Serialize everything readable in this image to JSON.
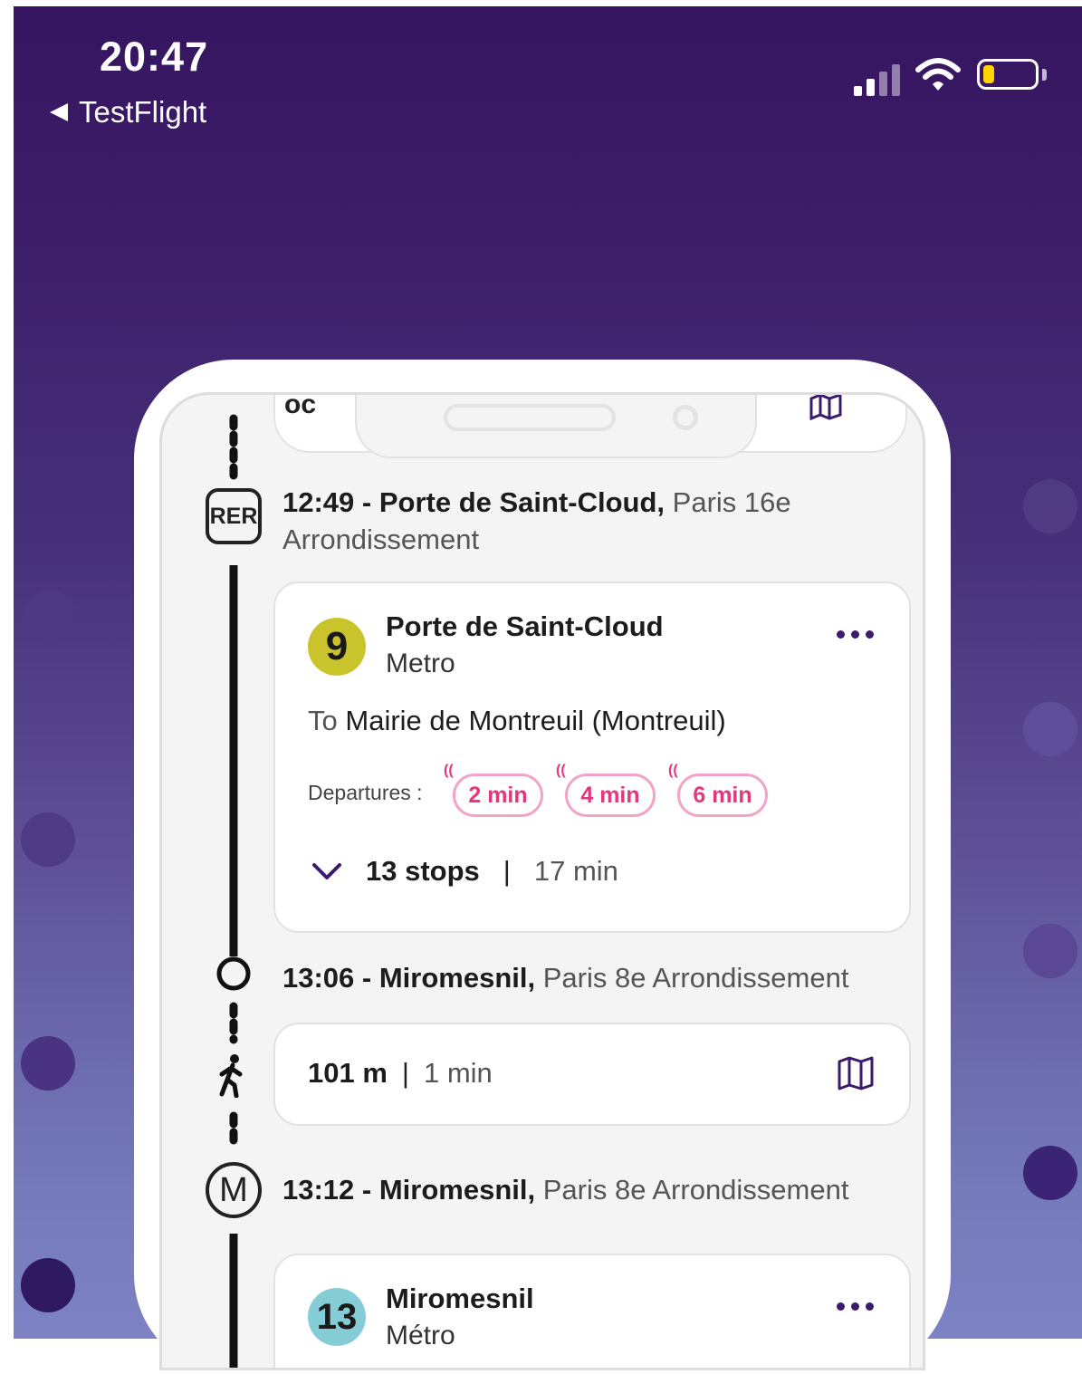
{
  "status_bar": {
    "time": "20:47",
    "back_label": "TestFlight",
    "icons": [
      "cellular-signal-icon",
      "wifi-icon",
      "battery-icon"
    ]
  },
  "header_fragment": {
    "text": "oc"
  },
  "colors": {
    "brand_purple": "#3c1a6b",
    "line9_yellow": "#c9c42b",
    "line13_cyan": "#85cdd6",
    "realtime_pink": "#e2387f"
  },
  "itinerary": {
    "stop1": {
      "time": "12:49",
      "name": "Porte de Saint-Cloud,",
      "area": "Paris 16e",
      "area2": "Arrondissement",
      "icon": "RER"
    },
    "leg1": {
      "line": "9",
      "station": "Porte de Saint-Cloud",
      "mode": "Metro",
      "direction_prefix": "To",
      "direction": "Mairie de Montreuil (Montreuil)",
      "departures_label": "Departures :",
      "departures": [
        "2 min",
        "4 min",
        "6 min"
      ],
      "stops": "13 stops",
      "separator": "|",
      "duration": "17 min"
    },
    "stop2": {
      "time": "13:06",
      "name": "Miromesnil,",
      "area": "Paris 8e Arrondissement"
    },
    "walk": {
      "distance": "101 m",
      "separator": "|",
      "duration": "1 min"
    },
    "stop3": {
      "time": "13:12",
      "name": "Miromesnil,",
      "area": "Paris 8e Arrondissement",
      "icon": "M"
    },
    "leg2": {
      "line": "13",
      "station": "Miromesnil",
      "mode": "Métro"
    }
  }
}
